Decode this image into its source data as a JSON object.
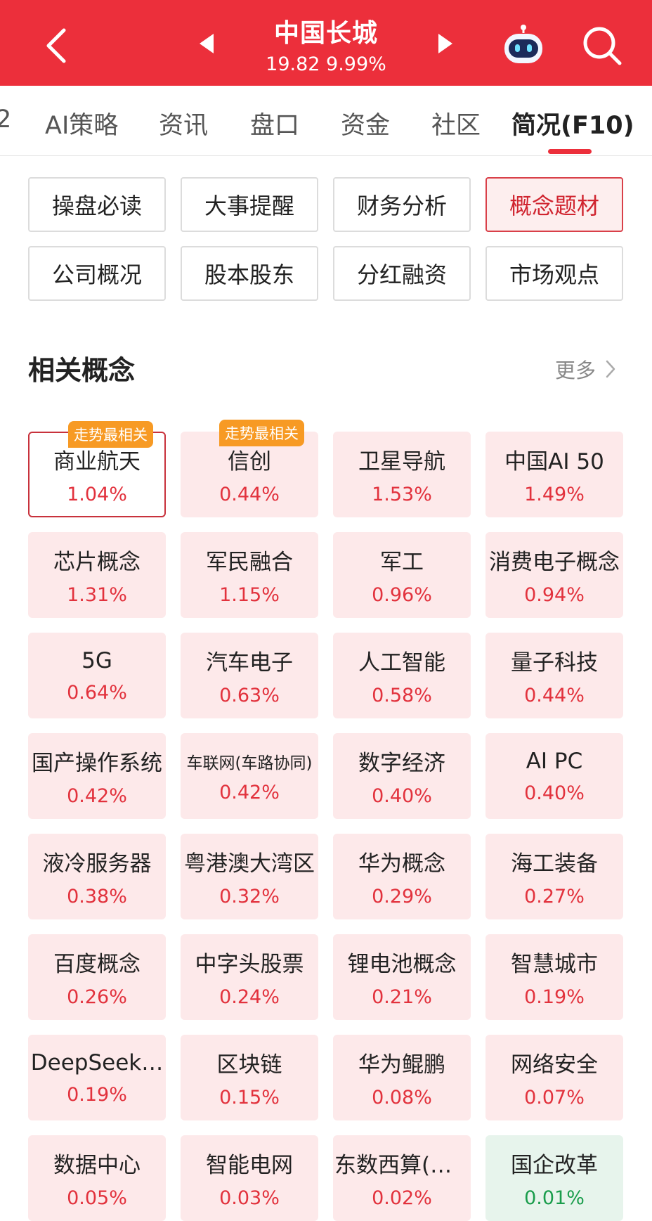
{
  "header": {
    "stock_name": "中国长城",
    "price_line": "19.82 9.99%",
    "bg_color": "#ec2f3b"
  },
  "tabs": [
    {
      "label": "2"
    },
    {
      "label": "AI策略"
    },
    {
      "label": "资讯"
    },
    {
      "label": "盘口"
    },
    {
      "label": "资金"
    },
    {
      "label": "社区"
    },
    {
      "label": "简况(F10)",
      "active": true
    }
  ],
  "segments": [
    {
      "label": "操盘必读"
    },
    {
      "label": "大事提醒"
    },
    {
      "label": "财务分析"
    },
    {
      "label": "概念题材",
      "active": true
    },
    {
      "label": "公司概况"
    },
    {
      "label": "股本股东"
    },
    {
      "label": "分红融资"
    },
    {
      "label": "市场观点"
    }
  ],
  "section": {
    "title": "相关概念",
    "more": "更多"
  },
  "concepts": [
    {
      "name": "商业航天",
      "change": "1.04%",
      "badge": "走势最相关",
      "outlined": true
    },
    {
      "name": "信创",
      "change": "0.44%",
      "badge": "走势最相关"
    },
    {
      "name": "卫星导航",
      "change": "1.53%"
    },
    {
      "name": "中国AI 50",
      "change": "1.49%"
    },
    {
      "name": "芯片概念",
      "change": "1.31%"
    },
    {
      "name": "军民融合",
      "change": "1.15%"
    },
    {
      "name": "军工",
      "change": "0.96%"
    },
    {
      "name": "消费电子概念",
      "change": "0.94%"
    },
    {
      "name": "5G",
      "change": "0.64%"
    },
    {
      "name": "汽车电子",
      "change": "0.63%"
    },
    {
      "name": "人工智能",
      "change": "0.58%"
    },
    {
      "name": "量子科技",
      "change": "0.44%"
    },
    {
      "name": "国产操作系统",
      "change": "0.42%"
    },
    {
      "name": "车联网(车路协同)",
      "change": "0.42%",
      "small": true
    },
    {
      "name": "数字经济",
      "change": "0.40%"
    },
    {
      "name": "AI PC",
      "change": "0.40%"
    },
    {
      "name": "液冷服务器",
      "change": "0.38%"
    },
    {
      "name": "粤港澳大湾区",
      "change": "0.32%"
    },
    {
      "name": "华为概念",
      "change": "0.29%"
    },
    {
      "name": "海工装备",
      "change": "0.27%"
    },
    {
      "name": "百度概念",
      "change": "0.26%"
    },
    {
      "name": "中字头股票",
      "change": "0.24%"
    },
    {
      "name": "锂电池概念",
      "change": "0.21%"
    },
    {
      "name": "智慧城市",
      "change": "0.19%"
    },
    {
      "name": "DeepSeek…",
      "change": "0.19%"
    },
    {
      "name": "区块链",
      "change": "0.15%"
    },
    {
      "name": "华为鲲鹏",
      "change": "0.08%"
    },
    {
      "name": "网络安全",
      "change": "0.07%"
    },
    {
      "name": "数据中心",
      "change": "0.05%"
    },
    {
      "name": "智能电网",
      "change": "0.03%"
    },
    {
      "name": "东数西算(算…",
      "change": "0.02%"
    },
    {
      "name": "国企改革",
      "change": "0.01%",
      "green": true
    }
  ]
}
